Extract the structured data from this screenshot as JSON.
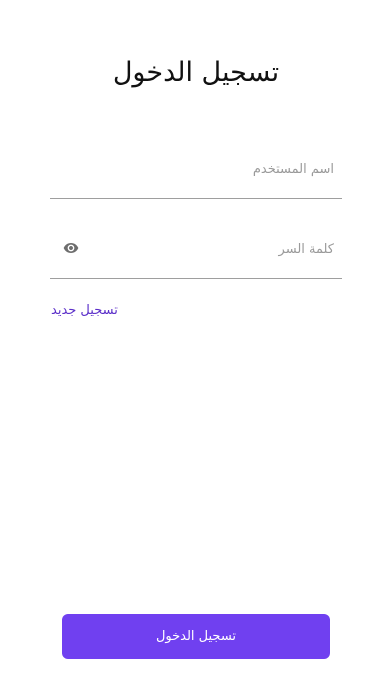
{
  "header": {
    "title": "تسجيل الدخول"
  },
  "form": {
    "username": {
      "value": "",
      "placeholder": "اسم المستخدم"
    },
    "password": {
      "value": "",
      "placeholder": "كلمة السر",
      "toggle_icon": "eye-icon"
    },
    "register_link": "تسجيل جديد",
    "submit_label": "تسجيل الدخول"
  },
  "colors": {
    "accent": "#7040f0",
    "link": "#5b2fc9",
    "underline": "#9e9e9e"
  }
}
